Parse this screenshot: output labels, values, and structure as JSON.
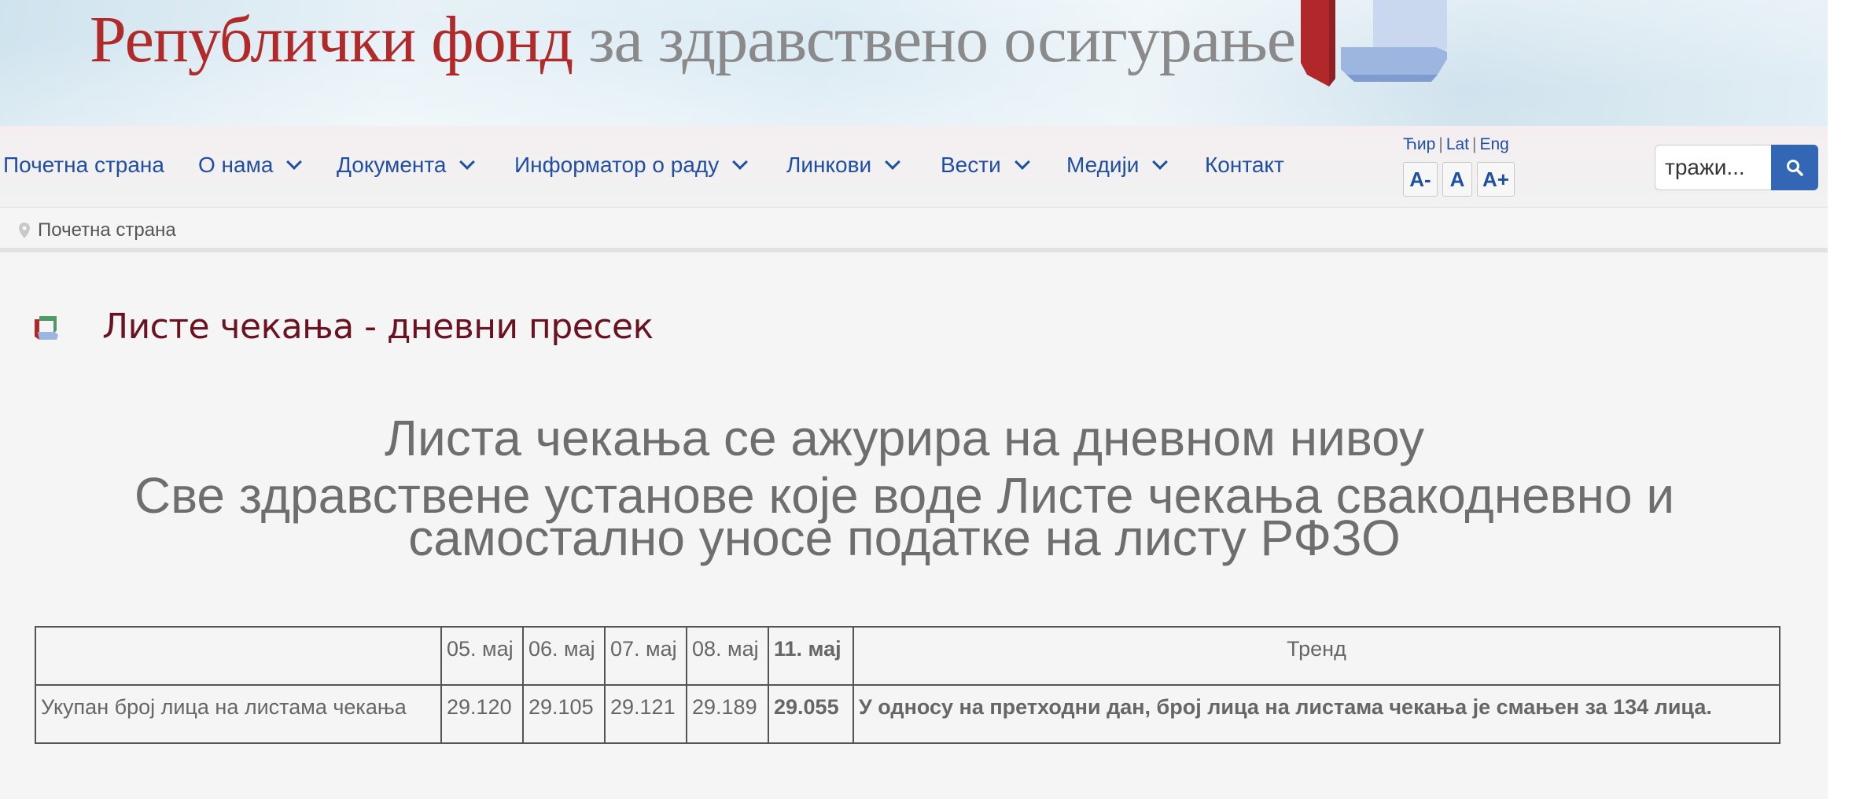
{
  "banner": {
    "title_red": "Републички фонд",
    "title_gray": " за здравствено осигурање"
  },
  "nav": {
    "items": [
      {
        "label": "Почетна страна"
      },
      {
        "label": "О нама"
      },
      {
        "label": "Документа"
      },
      {
        "label": "Информатор о раду"
      },
      {
        "label": "Линкови"
      },
      {
        "label": "Вести"
      },
      {
        "label": "Медији"
      },
      {
        "label": "Контакт"
      }
    ],
    "languages": [
      "Ћир",
      "Lat",
      "Eng"
    ],
    "font_sizes": [
      "A-",
      "A",
      "A+"
    ],
    "search": {
      "placeholder": "тражи..."
    }
  },
  "breadcrumb": {
    "home": "Почетна страна"
  },
  "section": {
    "title": "Листе чекања - дневни пресек"
  },
  "lead": {
    "line1": "Листа чекања се ажурира на дневном нивоу",
    "line2": "Све здравствене установе које воде Листе чекања свакодневно и самостално уносе податке на листу РФЗО"
  },
  "table": {
    "header": [
      "",
      "05. мај",
      "06. мај",
      "07. мај",
      "08. мај",
      "11. мај",
      "Тренд"
    ],
    "row": {
      "label": "Укупан број лица на листама чекања",
      "values": [
        "29.120",
        "29.105",
        "29.121",
        "29.189",
        "29.055"
      ],
      "trend": "У односу на претходни дан, број лица на листама чекања је смањен за 134 лица."
    }
  },
  "colors": {
    "nav_link": "#1f4fa3",
    "section_title": "#6b1221",
    "search_button": "#3466b6",
    "banner_red": "#b02a2a"
  }
}
